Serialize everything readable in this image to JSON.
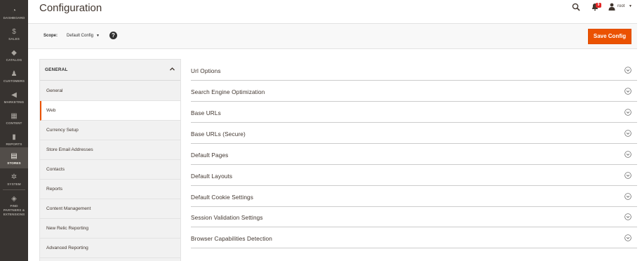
{
  "menu": {
    "items": [
      {
        "label": "DASHBOARD",
        "icon": "dashboard-icon",
        "glyph": "◔",
        "active": false
      },
      {
        "label": "SALES",
        "icon": "dollar-icon",
        "glyph": "$",
        "active": false
      },
      {
        "label": "CATALOG",
        "icon": "cube-icon",
        "glyph": "◆",
        "active": false
      },
      {
        "label": "CUSTOMERS",
        "icon": "person-icon",
        "glyph": "♟",
        "active": false
      },
      {
        "label": "MARKETING",
        "icon": "megaphone-icon",
        "glyph": "◀",
        "active": false
      },
      {
        "label": "CONTENT",
        "icon": "layout-icon",
        "glyph": "▦",
        "active": false
      },
      {
        "label": "REPORTS",
        "icon": "bar-chart-icon",
        "glyph": "▮",
        "active": false
      },
      {
        "label": "STORES",
        "icon": "store-icon",
        "glyph": "▤",
        "active": true
      },
      {
        "label": "SYSTEM",
        "icon": "gear-icon",
        "glyph": "✲",
        "active": false
      },
      {
        "label": "FIND PARTNERS & EXTENSIONS",
        "icon": "partners-cube-icon",
        "glyph": "◈",
        "active": false
      }
    ]
  },
  "header": {
    "title": "Configuration",
    "notifications_count": "9",
    "user": "root"
  },
  "scope": {
    "label": "Scope:",
    "value": "Default Config",
    "help": "?"
  },
  "actions": {
    "save_label": "Save Config"
  },
  "colors": {
    "accent": "#eb5202",
    "menu_bg": "#373330",
    "badge": "#e22626"
  },
  "sidebar": {
    "group_title": "GENERAL",
    "items": [
      {
        "label": "General",
        "active": false
      },
      {
        "label": "Web",
        "active": true
      },
      {
        "label": "Currency Setup",
        "active": false
      },
      {
        "label": "Store Email Addresses",
        "active": false
      },
      {
        "label": "Contacts",
        "active": false
      },
      {
        "label": "Reports",
        "active": false
      },
      {
        "label": "Content Management",
        "active": false
      },
      {
        "label": "New Relic Reporting",
        "active": false
      },
      {
        "label": "Advanced Reporting",
        "active": false
      }
    ]
  },
  "sections": [
    "Url Options",
    "Search Engine Optimization",
    "Base URLs",
    "Base URLs (Secure)",
    "Default Pages",
    "Default Layouts",
    "Default Cookie Settings",
    "Session Validation Settings",
    "Browser Capabilities Detection"
  ]
}
